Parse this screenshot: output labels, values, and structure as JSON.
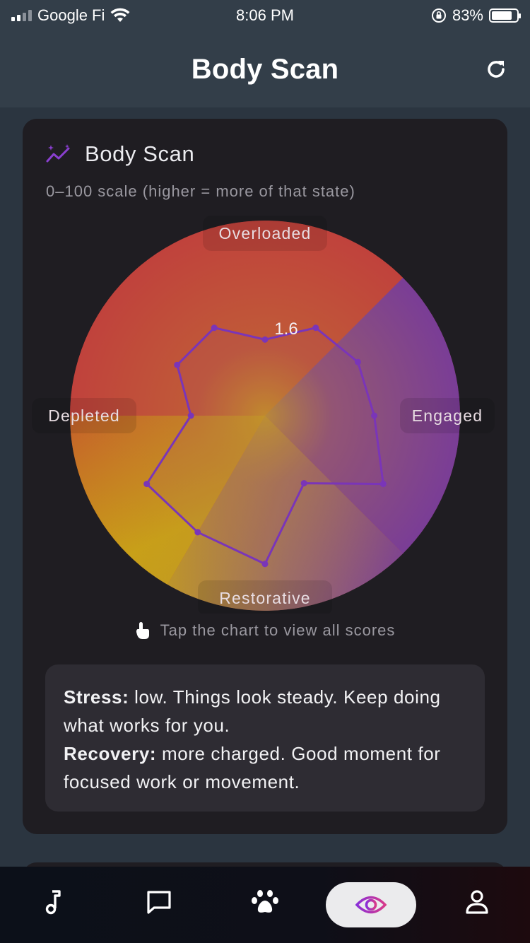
{
  "status_bar": {
    "carrier": "Google Fi",
    "time": "8:06 PM",
    "battery_percent": "83%",
    "battery_level": 0.83
  },
  "header": {
    "title": "Body Scan",
    "refresh_icon": "refresh-icon"
  },
  "card": {
    "title": "Body Scan",
    "title_icon": "sparkle-trend-icon",
    "scale_note": "0–100 scale (higher = more of that state)",
    "tap_hint": "Tap the chart to view all scores",
    "tap_icon": "hand-pointer-icon"
  },
  "chart_data": {
    "type": "radar",
    "quadrant_labels": {
      "top": "Overloaded",
      "right": "Engaged",
      "bottom": "Restorative",
      "left": "Depleted"
    },
    "quadrant_colors": {
      "overloaded": "#c0423c",
      "engaged": "#7a3d96",
      "restorative": "#9a6a7a",
      "depleted": "#c89a1c"
    },
    "center_value_label": "1.6",
    "range": [
      0,
      100
    ],
    "points": [
      {
        "angle_deg": 0,
        "value": 39
      },
      {
        "angle_deg": 30,
        "value": 52
      },
      {
        "angle_deg": 60,
        "value": 55
      },
      {
        "angle_deg": 90,
        "value": 56
      },
      {
        "angle_deg": 120,
        "value": 70
      },
      {
        "angle_deg": 150,
        "value": 40
      },
      {
        "angle_deg": 180,
        "value": 76
      },
      {
        "angle_deg": 210,
        "value": 69
      },
      {
        "angle_deg": 240,
        "value": 70
      },
      {
        "angle_deg": 270,
        "value": 38
      },
      {
        "angle_deg": 300,
        "value": 52
      },
      {
        "angle_deg": 330,
        "value": 52
      }
    ],
    "line_color": "#7a35b8"
  },
  "summary": {
    "stress_label": "Stress:",
    "stress_text": " low. Things look steady. Keep doing what works for you.",
    "recovery_label": "Recovery:",
    "recovery_text": " more charged. Good moment for focused work or movement."
  },
  "tabbar": {
    "items": [
      {
        "icon": "music-note-icon"
      },
      {
        "icon": "chat-bubble-icon"
      },
      {
        "icon": "paw-icon"
      },
      {
        "icon": "eye-icon",
        "active": true
      },
      {
        "icon": "person-icon"
      }
    ]
  }
}
